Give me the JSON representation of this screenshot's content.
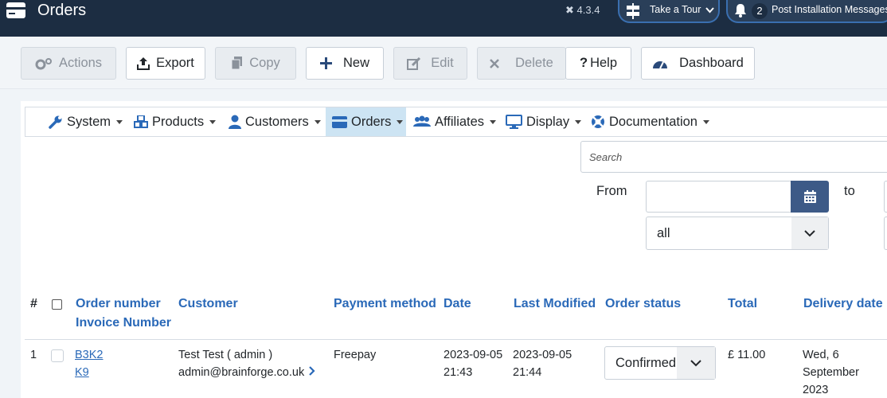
{
  "header": {
    "title": "Orders",
    "version": "4.3.4",
    "tour_label": "Take a Tour",
    "notification_count": "2",
    "notification_label": "Post Installation Messages"
  },
  "toolbar": {
    "actions": "Actions",
    "export": "Export",
    "copy": "Copy",
    "new": "New",
    "edit": "Edit",
    "delete": "Delete",
    "help": "Help",
    "dashboard": "Dashboard"
  },
  "menu": {
    "system": "System",
    "products": "Products",
    "customers": "Customers",
    "orders": "Orders",
    "affiliates": "Affiliates",
    "display": "Display",
    "documentation": "Documentation"
  },
  "filters": {
    "search_placeholder": "Search",
    "from_label": "From",
    "to_label": "to",
    "status_value": "all"
  },
  "table": {
    "headers": {
      "index": "#",
      "order_number": "Order number",
      "invoice_number": "Invoice Number",
      "customer": "Customer",
      "payment_method": "Payment method",
      "date": "Date",
      "last_modified": "Last Modified",
      "order_status": "Order status",
      "total": "Total",
      "delivery_date": "Delivery date"
    },
    "rows": [
      {
        "index": "1",
        "order_number": "B3K2",
        "invoice_number": "K9",
        "customer_name": "Test Test ( admin )",
        "customer_email": "admin@brainforge.co.uk",
        "payment_method": "Freepay",
        "date_day": "2023-09-05",
        "date_time": "21:43",
        "modified_day": "2023-09-05",
        "modified_time": "21:44",
        "status": "Confirmed",
        "total": "£ 11.00",
        "delivery_line1": "Wed, 6",
        "delivery_line2": "September",
        "delivery_line3": "2023"
      }
    ]
  },
  "colors": {
    "header_bg": "#1c2d42",
    "link": "#2a69b8",
    "active_menu": "#cde4f3",
    "calendar_button": "#3d5a87"
  }
}
